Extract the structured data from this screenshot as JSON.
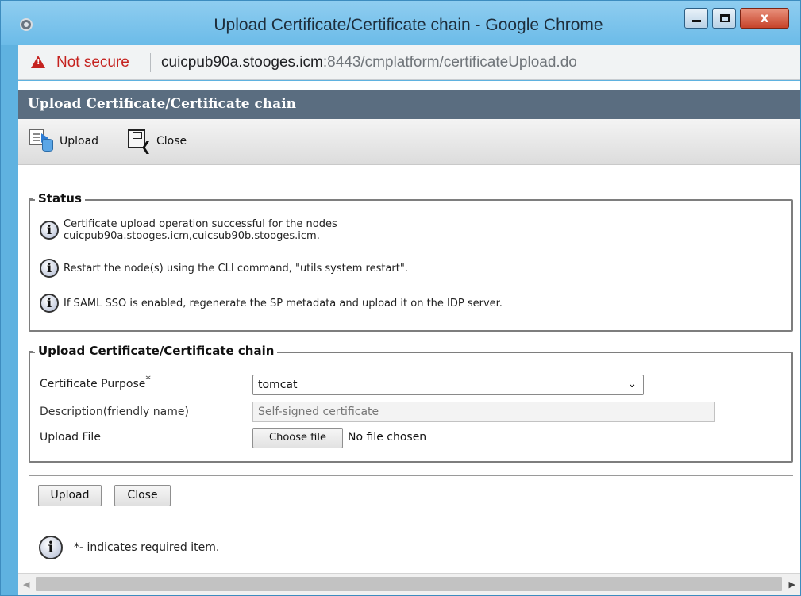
{
  "window": {
    "title": "Upload Certificate/Certificate chain - Google Chrome",
    "minimize_glyph": "–",
    "close_glyph": "x"
  },
  "address_bar": {
    "security_label": "Not secure",
    "host": "cuicpub90a.stooges.icm",
    "path": ":8443/cmplatform/certificateUpload.do"
  },
  "page": {
    "header_title": "Upload Certificate/Certificate chain",
    "toolbar": {
      "upload_label": "Upload",
      "close_label": "Close"
    },
    "status": {
      "legend": "Status",
      "messages": [
        {
          "line1": "Certificate upload operation successful for the nodes",
          "line2": "cuicpub90a.stooges.icm,cuicsub90b.stooges.icm."
        },
        {
          "line1": "Restart the node(s) using the CLI command, \"utils system restart\"."
        },
        {
          "line1": "If SAML SSO is enabled, regenerate the SP metadata and upload it on the IDP server."
        }
      ]
    },
    "upload_form": {
      "legend": "Upload Certificate/Certificate chain",
      "purpose_label": "Certificate Purpose",
      "required_mark": "*",
      "purpose_value": "tomcat",
      "description_label": "Description(friendly name)",
      "description_placeholder": "Self-signed certificate",
      "file_label": "Upload File",
      "choose_file_label": "Choose file",
      "file_status": "No file chosen"
    },
    "buttons": {
      "upload": "Upload",
      "close": "Close"
    },
    "required_note": "*- indicates required item."
  },
  "icons": {
    "info": "info-icon",
    "warning": "warning-triangle-icon"
  },
  "colors": {
    "header_bar": "#5a6d80",
    "title_bar": "#6bbbe8",
    "not_secure": "#c5221f"
  }
}
